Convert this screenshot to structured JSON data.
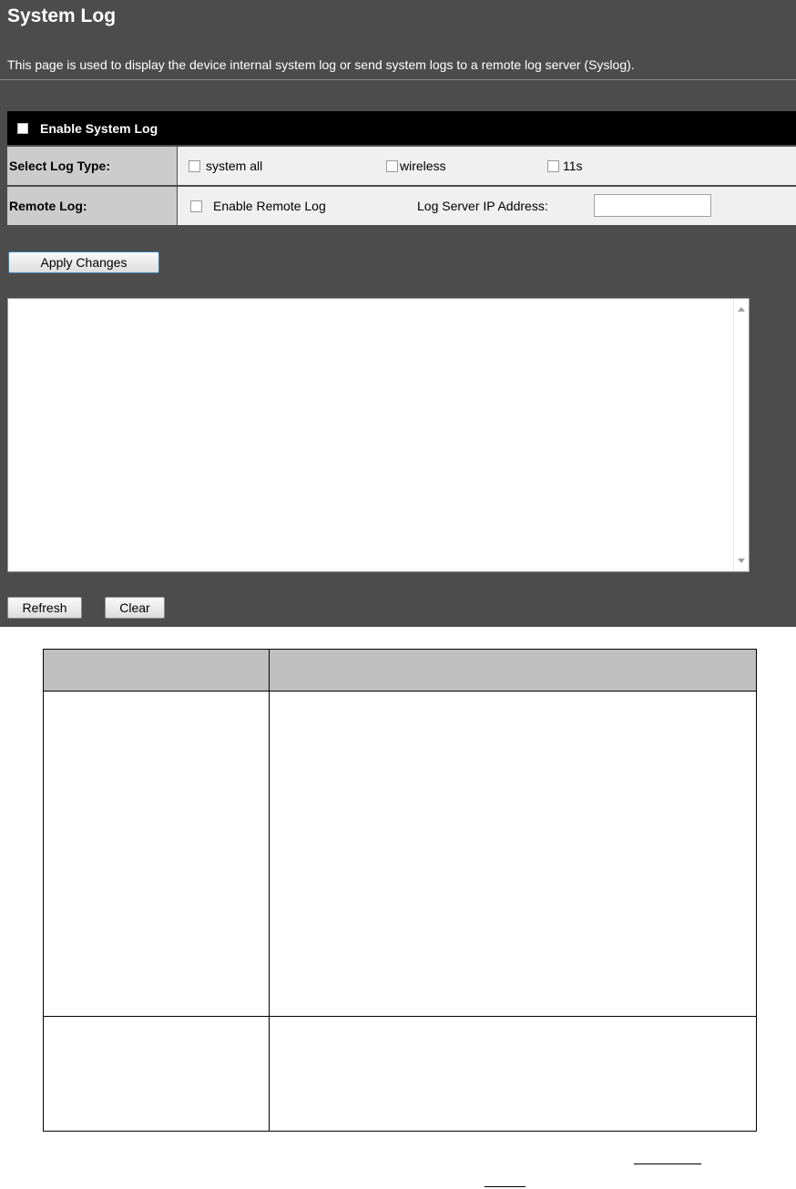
{
  "page": {
    "title": "System Log",
    "description": "This page is used to display the device internal system log or send system logs to a remote log server (Syslog)."
  },
  "enable_system_log": {
    "label": "Enable System Log",
    "checked": false
  },
  "log_type": {
    "label": "Select Log Type:",
    "options": [
      {
        "label": "system all",
        "checked": false
      },
      {
        "label": "wireless",
        "checked": false
      },
      {
        "label": "11s",
        "checked": false
      }
    ]
  },
  "remote_log": {
    "label": "Remote Log:",
    "enable_label": "Enable Remote Log",
    "enable_checked": false,
    "server_ip_label": "Log Server IP Address:",
    "server_ip_value": ""
  },
  "buttons": {
    "apply": "Apply Changes",
    "refresh": "Refresh",
    "clear": "Clear"
  },
  "log_text": "",
  "colors": {
    "panel_bg": "#4c4c4c",
    "header_bar": "#000000",
    "label_cell": "#cccccc",
    "value_cell": "#f0f0f0",
    "apply_border": "#3c7fb1",
    "table_header": "#bfbfbf"
  }
}
